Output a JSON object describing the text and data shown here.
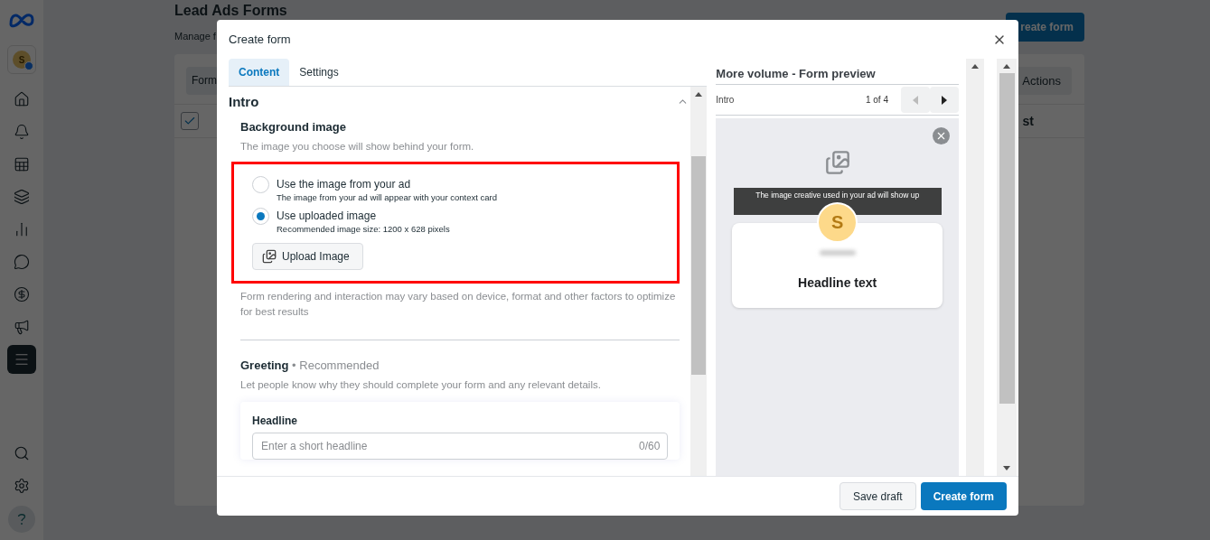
{
  "background": {
    "sidebar": {
      "account_initial": "S",
      "nav_items": [
        {
          "selected": false
        },
        {
          "selected": false
        },
        {
          "selected": false
        },
        {
          "selected": false
        },
        {
          "selected": false
        },
        {
          "selected": false
        },
        {
          "selected": false
        },
        {
          "selected": false
        },
        {
          "selected": true
        }
      ]
    },
    "title": "Lead Ads Forms",
    "subtitle": "Manage f",
    "create_button": "reate form",
    "table_tab": "Form",
    "actions_button": "Actions",
    "header_checked": true,
    "column_fragment": "st"
  },
  "modal": {
    "title": "Create form",
    "tabs": [
      {
        "label": "Content",
        "selected": true
      },
      {
        "label": "Settings",
        "selected": false
      }
    ],
    "section": {
      "title": "Intro",
      "expanded": true
    },
    "background_image": {
      "title": "Background image",
      "description": "The image you choose will show behind your form.",
      "options": [
        {
          "label": "Use the image from your ad",
          "hint": "The image from your ad will appear with your context card",
          "selected": false
        },
        {
          "label": "Use uploaded image",
          "hint": "Recommended image size: 1200 x 628 pixels",
          "selected": true
        }
      ],
      "upload_button": "Upload Image",
      "note": "Form rendering and interaction may vary based on device, format and other factors to optimize for best results"
    },
    "greeting": {
      "title": "Greeting",
      "tag": "• Recommended",
      "description": "Let people know why they should complete your form and any relevant details.",
      "headline_label": "Headline",
      "headline_placeholder": "Enter a short headline",
      "counter": "0/60"
    },
    "preview": {
      "title": "More volume - Form preview",
      "step": "Intro",
      "page": "1 of 4",
      "prev_disabled": true,
      "banner": "The image creative used in your ad will show up",
      "avatar": "S",
      "headline": "Headline text"
    },
    "footer": [
      {
        "label": "Save draft",
        "kind": "secondary"
      },
      {
        "label": "Create form",
        "kind": "primary"
      }
    ]
  }
}
